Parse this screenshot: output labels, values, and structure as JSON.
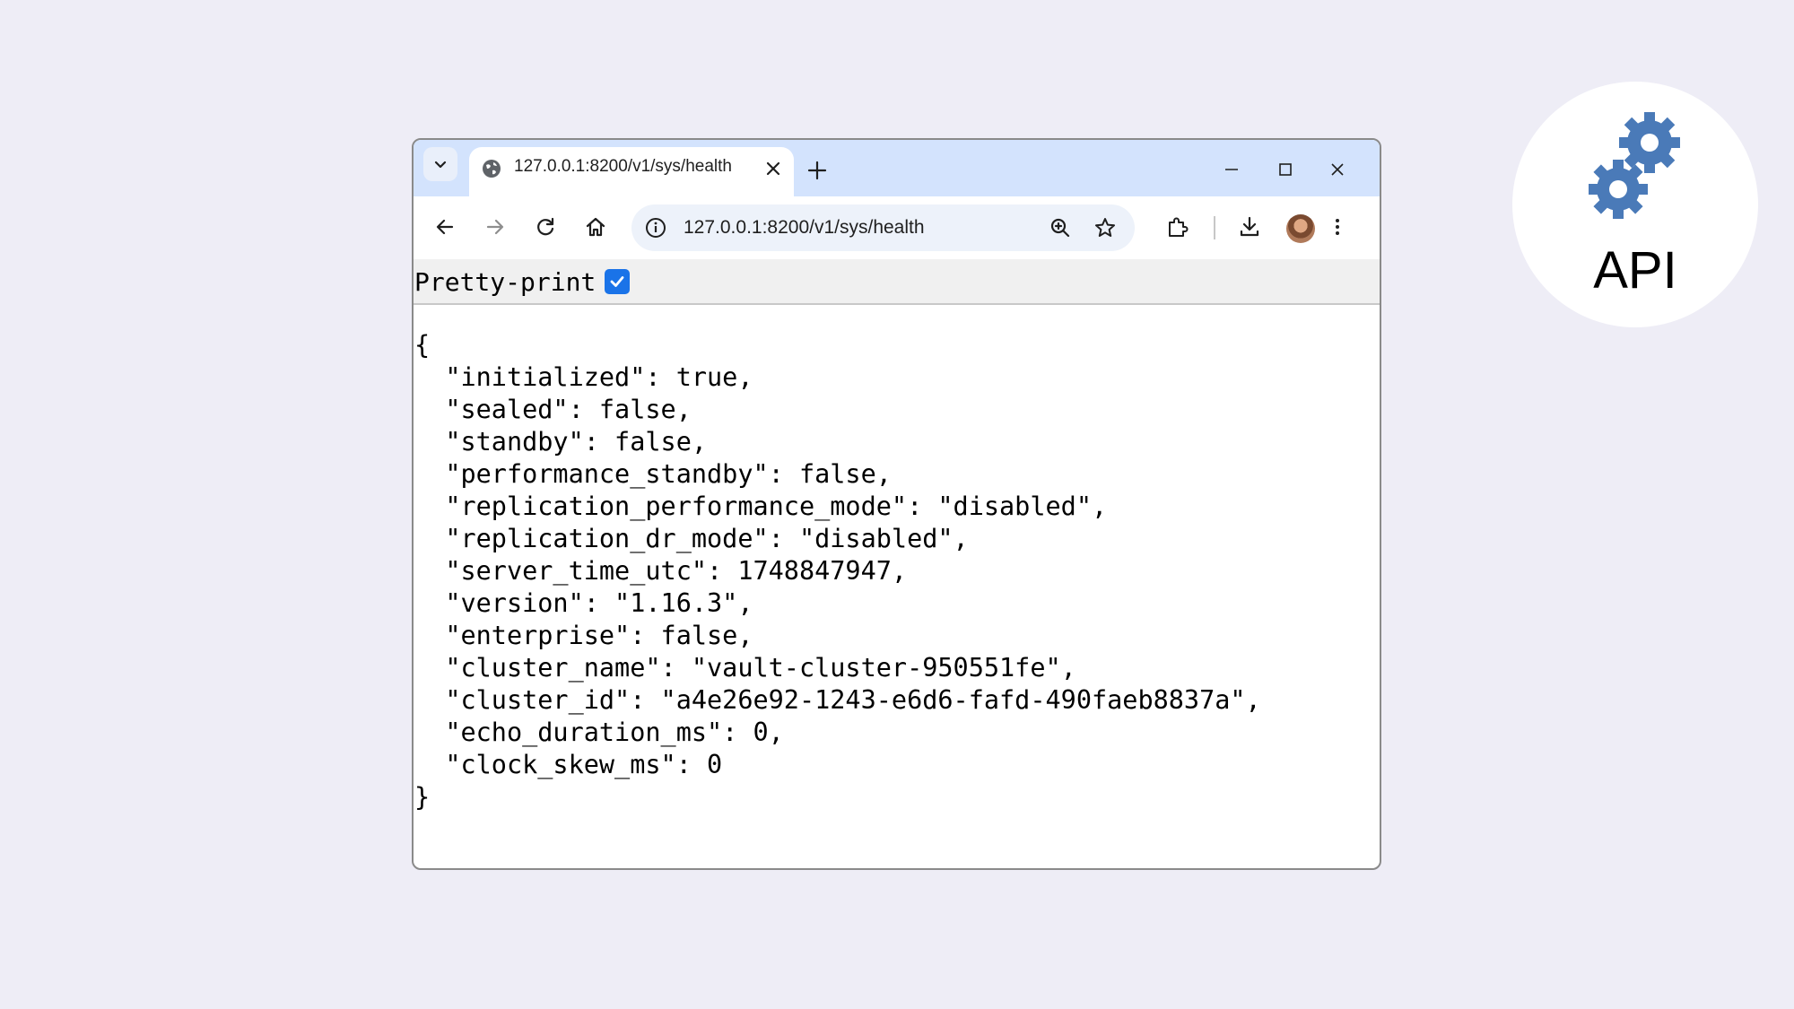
{
  "tab": {
    "title": "127.0.0.1:8200/v1/sys/health"
  },
  "omnibox": {
    "url": "127.0.0.1:8200/v1/sys/health"
  },
  "viewer": {
    "pretty_print_label": "Pretty-print",
    "pretty_print_checked": true
  },
  "json_lines": [
    "{",
    "  \"initialized\": true,",
    "  \"sealed\": false,",
    "  \"standby\": false,",
    "  \"performance_standby\": false,",
    "  \"replication_performance_mode\": \"disabled\",",
    "  \"replication_dr_mode\": \"disabled\",",
    "  \"server_time_utc\": 1748847947,",
    "  \"version\": \"1.16.3\",",
    "  \"enterprise\": false,",
    "  \"cluster_name\": \"vault-cluster-950551fe\",",
    "  \"cluster_id\": \"a4e26e92-1243-e6d6-fafd-490faeb8837a\",",
    "  \"echo_duration_ms\": 0,",
    "  \"clock_skew_ms\": 0",
    "}"
  ],
  "badge": {
    "label": "API",
    "icon": "gears-icon",
    "color": "#4a7ab8"
  },
  "colors": {
    "background": "#eeedf6",
    "tabstrip": "#d3e3fd",
    "accent": "#1a73e8"
  }
}
